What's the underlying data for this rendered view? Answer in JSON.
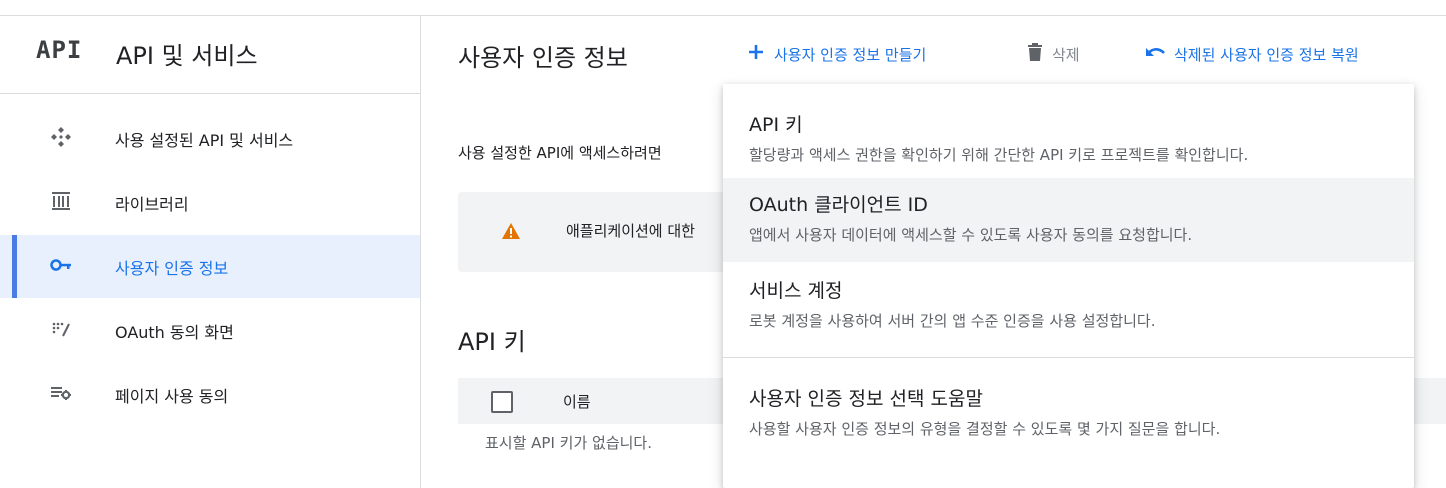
{
  "sidebar": {
    "logo": "API",
    "title": "API 및 서비스",
    "items": [
      {
        "label": "사용 설정된 API 및 서비스",
        "icon": "apis-icon"
      },
      {
        "label": "라이브러리",
        "icon": "library-icon"
      },
      {
        "label": "사용자 인증 정보",
        "icon": "key-icon",
        "active": true
      },
      {
        "label": "OAuth 동의 화면",
        "icon": "consent-icon"
      },
      {
        "label": "페이지 사용 동의",
        "icon": "settings-list-icon"
      }
    ]
  },
  "header": {
    "title": "사용자 인증 정보",
    "create_label": "사용자 인증 정보 만들기",
    "delete_label": "삭제",
    "restore_label": "삭제된 사용자 인증 정보 복원"
  },
  "main": {
    "intro": "사용 설정한 API에 액세스하려면",
    "notice": "애플리케이션에 대한",
    "section_title": "API 키",
    "table_header_name": "이름",
    "empty_message": "표시할 API 키가 없습니다."
  },
  "menu": {
    "items": [
      {
        "title": "API 키",
        "desc": "할당량과 액세스 권한을 확인하기 위해 간단한 API 키로 프로젝트를 확인합니다."
      },
      {
        "title": "OAuth 클라이언트 ID",
        "desc": "앱에서 사용자 데이터에 액세스할 수 있도록 사용자 동의를 요청합니다."
      },
      {
        "title": "서비스 계정",
        "desc": "로봇 계정을 사용하여 서버 간의 앱 수준 인증을 사용 설정합니다."
      },
      {
        "title": "사용자 인증 정보 선택 도움말",
        "desc": "사용할 사용자 인증 정보의 유형을 결정할 수 있도록 몇 가지 질문을 합니다."
      }
    ]
  },
  "colors": {
    "accent": "#1a73e8",
    "active_bg": "#e8f0fe",
    "warning": "#e37400"
  }
}
